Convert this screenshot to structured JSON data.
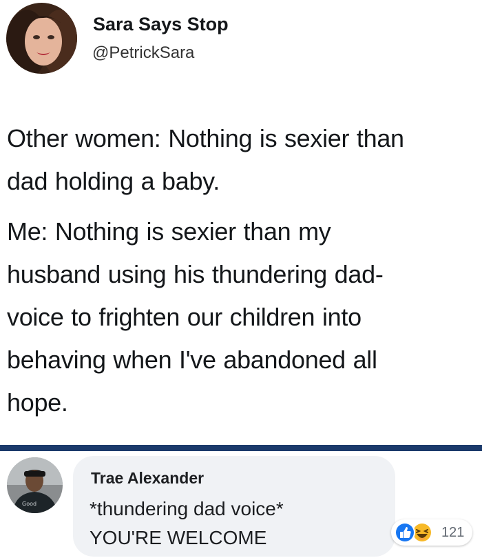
{
  "tweet": {
    "display_name": "Sara Says Stop",
    "handle": "@PetrickSara",
    "paragraphs": [
      [
        "Other women: Nothing is sexier than",
        "dad holding a baby."
      ],
      [
        "Me: Nothing is sexier than my",
        "husband using his thundering dad-",
        "voice to frighten our children into",
        "behaving when I've abandoned all",
        "hope."
      ]
    ],
    "avatar_icon": "profile-photo-icon"
  },
  "comment": {
    "author": "Trae Alexander",
    "lines": [
      "*thundering dad voice*",
      "YOU'RE WELCOME"
    ],
    "avatar_icon": "profile-photo-icon",
    "reactions": {
      "icons": [
        "like-icon",
        "haha-icon"
      ],
      "count": "121"
    }
  },
  "colors": {
    "divider": "#1b3a6b",
    "bubble": "#f0f2f5",
    "like_blue": "#1877f2",
    "haha_yellow": "#f7b928"
  }
}
